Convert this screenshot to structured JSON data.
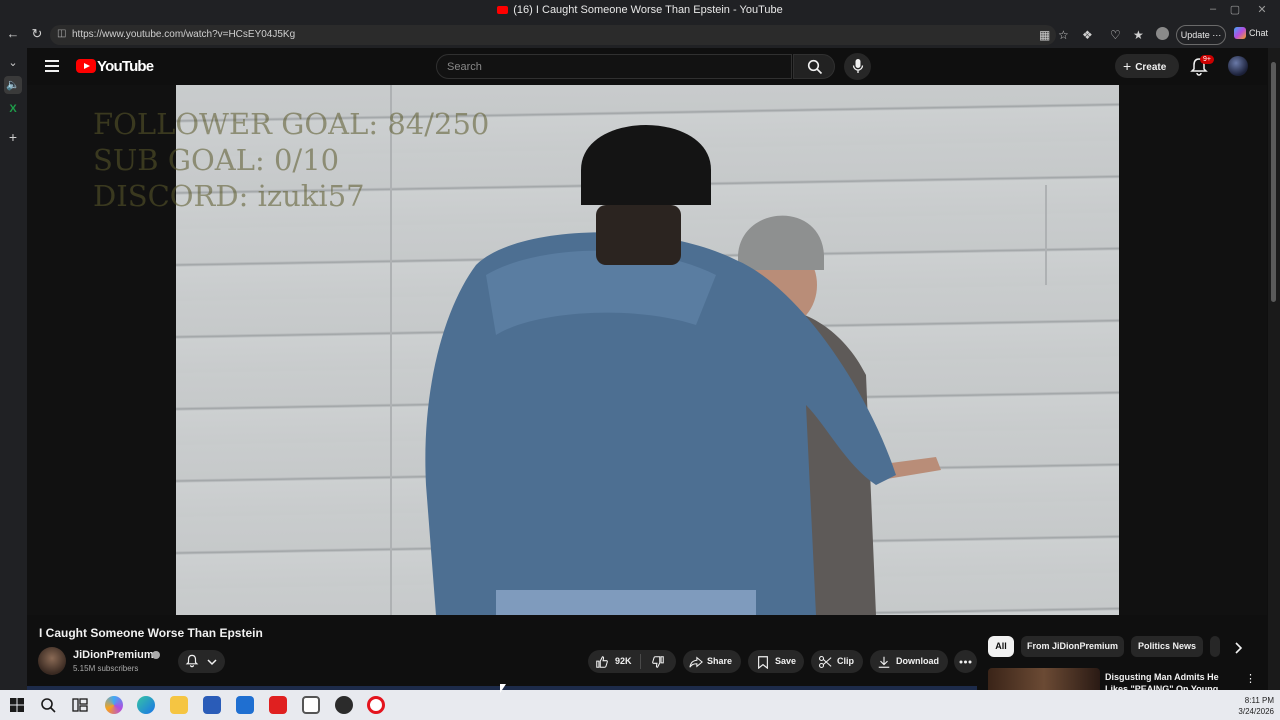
{
  "window": {
    "title": "(16) I Caught Someone Worse Than Epstein - YouTube"
  },
  "browser": {
    "url": "https://www.youtube.com/watch?v=HCsEY04J5Kg",
    "update_label": "Update",
    "chat_label": "Chat"
  },
  "masthead": {
    "logo_text": "YouTube",
    "search_placeholder": "Search",
    "create_label": "Create",
    "notification_badge": "9+"
  },
  "video_overlay": {
    "line1": "FOLLOWER GOAL:  84/250",
    "line2": "SUB GOAL: 0/10",
    "line3": "DISCORD: izuki57"
  },
  "video": {
    "title": "I Caught Someone Worse Than Epstein",
    "channel_name": "JiDionPremium",
    "subscribers": "5.15M subscribers",
    "likes": "92K",
    "actions": {
      "share": "Share",
      "save": "Save",
      "clip": "Clip",
      "download": "Download"
    }
  },
  "chips": [
    "All",
    "From JiDionPremium",
    "Politics News"
  ],
  "recommendation": {
    "title": "Disgusting Man Admits He Likes \"PEAING\" On Young Girls"
  },
  "taskbar": {
    "time": "8:11 PM",
    "date": "3/24/2026"
  },
  "colors": {
    "yt_red": "#ff0000",
    "bg": "#0f0f0f",
    "pill": "#272727"
  }
}
